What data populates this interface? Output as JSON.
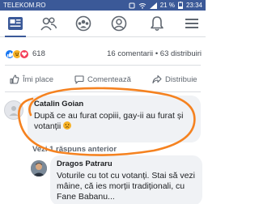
{
  "status_bar": {
    "carrier": "TELEKOM.RO",
    "battery": "21 %",
    "time": "23:34",
    "icons": [
      "notification-icon",
      "wifi-icon",
      "signal-icon",
      "battery-icon"
    ]
  },
  "nav": {
    "items": [
      "feed-icon",
      "friends-icon",
      "groups-icon",
      "profile-icon",
      "notifications-icon",
      "menu-icon"
    ],
    "active": "feed-icon",
    "accent": "#3b5998"
  },
  "post": {
    "reaction_count": "618",
    "comments": "16 comentarii",
    "shares": "63 distribuiri",
    "reactions": [
      "like-icon",
      "haha-icon",
      "love-icon"
    ]
  },
  "actions": {
    "like": "Îmi place",
    "comment": "Comentează",
    "share": "Distribuie"
  },
  "comment": {
    "author": "Catalin Goian",
    "text": "După ce au furat copiii, gay-ii au furat și votanții"
  },
  "view_replies": "Vezi 1 răspuns anterior",
  "reply": {
    "author": "Dragos Patraru",
    "text": "Voturile cu tot cu votanți. Stai să vezi mâine, că ies morții tradiționali, cu Fane Babanu..."
  },
  "colors": {
    "brand": "#3b5998",
    "annotation": "#f58220",
    "bubble": "#f0f2f5"
  }
}
